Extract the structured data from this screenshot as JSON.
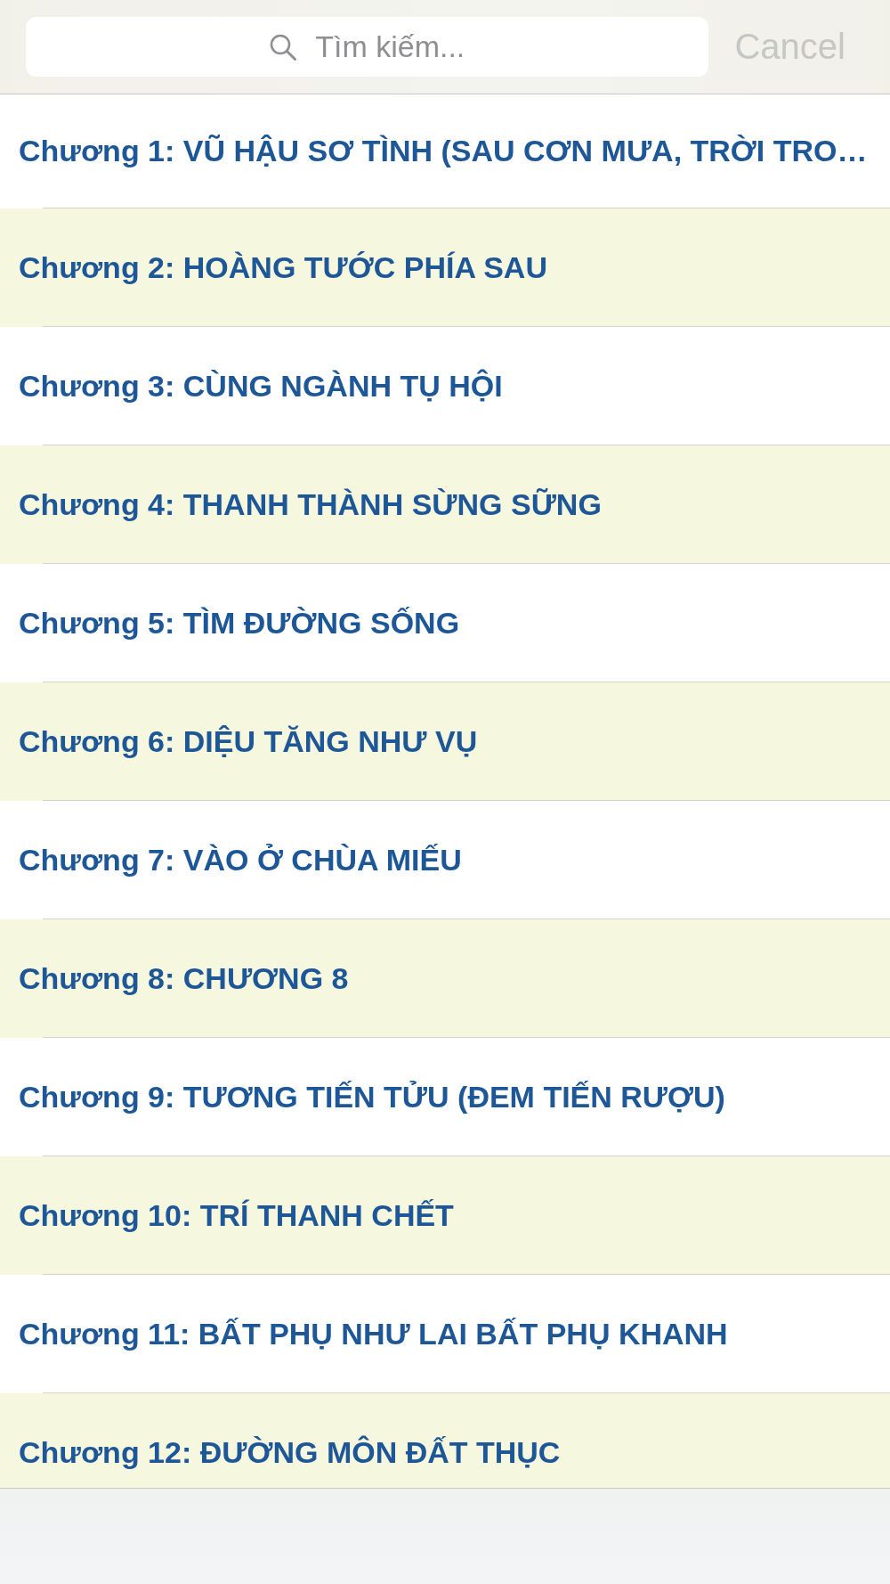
{
  "search_bar": {
    "placeholder": "Tìm kiếm...",
    "cancel": {
      "label": "Cancel",
      "disabled": true
    }
  },
  "chapters": [
    {
      "title": "Chương 1: VŨ HẬU SƠ TÌNH (SAU CƠN MƯA, TRỜI TRO…"
    },
    {
      "title": "Chương 2: HOÀNG TƯỚC PHÍA SAU"
    },
    {
      "title": "Chương 3: CÙNG NGÀNH TỤ HỘI"
    },
    {
      "title": "Chương 4: THANH THÀNH SỪNG SỮNG"
    },
    {
      "title": "Chương 5: TÌM ĐƯỜNG SỐNG"
    },
    {
      "title": "Chương 6: DIỆU TĂNG NHƯ VỤ"
    },
    {
      "title": "Chương 7: VÀO Ở CHÙA MIẾU"
    },
    {
      "title": "Chương 8: CHƯƠNG 8"
    },
    {
      "title": "Chương 9: TƯƠNG TIẾN TỬU (ĐEM TIẾN RƯỢU)"
    },
    {
      "title": "Chương 10: TRÍ THANH CHẾT"
    },
    {
      "title": "Chương 11: BẤT PHỤ NHƯ LAI BẤT PHỤ KHANH"
    },
    {
      "title": "Chương 12: ĐƯỜNG MÔN ĐẤT THỤC"
    }
  ]
}
